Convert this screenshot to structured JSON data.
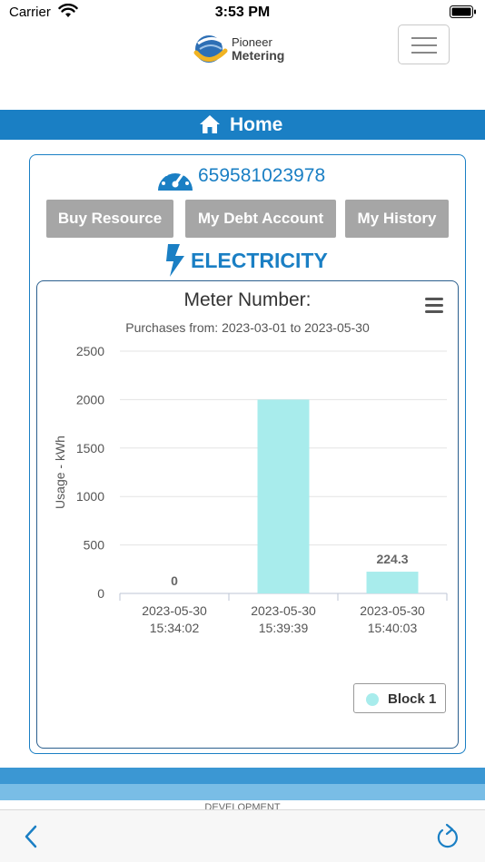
{
  "status_bar": {
    "carrier": "Carrier",
    "time": "3:53 PM"
  },
  "header": {
    "logo_line1": "Pioneer",
    "logo_line2": "Metering"
  },
  "page": {
    "title": "Home"
  },
  "meter": {
    "id": "659581023978"
  },
  "buttons": {
    "buy": "Buy Resource",
    "debt": "My Debt Account",
    "history": "My History"
  },
  "resource": {
    "label": "ELECTRICITY"
  },
  "colors": {
    "accent": "#1a7fc4",
    "button_gray": "#a6a6a6",
    "bar": "#a8ecec"
  },
  "icons": {
    "wifi": "wifi-icon",
    "battery": "battery-icon",
    "menu": "hamburger-icon",
    "home": "home-icon",
    "gauge": "gauge-icon",
    "electricity": "lightning-icon",
    "chart_menu": "chart-menu-icon",
    "back": "chevron-left-icon",
    "reload": "reload-icon"
  },
  "chart_data": {
    "type": "bar",
    "title": "Meter Number:",
    "subtitle": "Purchases from: 2023-03-01 to 2023-05-30",
    "ylabel": "Usage - kWh",
    "ylim": [
      0,
      2500
    ],
    "yticks": [
      0,
      500,
      1000,
      1500,
      2000,
      2500
    ],
    "categories": [
      [
        "2023-05-30",
        "15:34:02"
      ],
      [
        "2023-05-30",
        "15:39:39"
      ],
      [
        "2023-05-30",
        "15:40:03"
      ]
    ],
    "series": [
      {
        "name": "Block 1",
        "values": [
          0,
          2000,
          224.3
        ],
        "data_labels": [
          "0",
          "",
          "224.3"
        ]
      }
    ],
    "grid": true,
    "legend": "bottom-right"
  },
  "footer": {
    "text": "DEVELOPMENT"
  }
}
